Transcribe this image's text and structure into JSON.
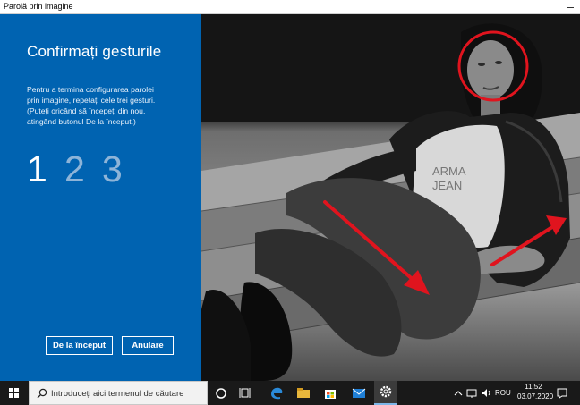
{
  "window": {
    "title": "Parolă prin imagine"
  },
  "panel": {
    "heading": "Confirmați gesturile",
    "instructions_line1": "Pentru a termina configurarea parolei",
    "instructions_line2": "prin imagine, repetați cele trei gesturi.",
    "instructions_line3": "(Puteți oricând să începeți din nou,",
    "instructions_line4": "atingând butonul De la început.)",
    "steps": [
      "1",
      "2",
      "3"
    ],
    "active_step": 1,
    "start_over_label": "De la început",
    "cancel_label": "Anulare"
  },
  "photo": {
    "shirt_text_1": "ARMA",
    "shirt_text_2": "JEAN"
  },
  "taskbar": {
    "search_placeholder": "Introduceți aici termenul de căutare",
    "language": "ROU",
    "time": "11:52",
    "date": "03.07.2020"
  },
  "colors": {
    "panel_blue": "#0063b1",
    "gesture_red": "#e0141e",
    "taskbar": "#191919"
  },
  "icons": [
    "windows-start-icon",
    "search-icon",
    "cortana-icon",
    "task-view-icon",
    "edge-icon",
    "file-explorer-icon",
    "store-icon",
    "mail-icon",
    "settings-icon",
    "chevron-up-icon",
    "network-icon",
    "volume-icon",
    "notification-icon"
  ]
}
